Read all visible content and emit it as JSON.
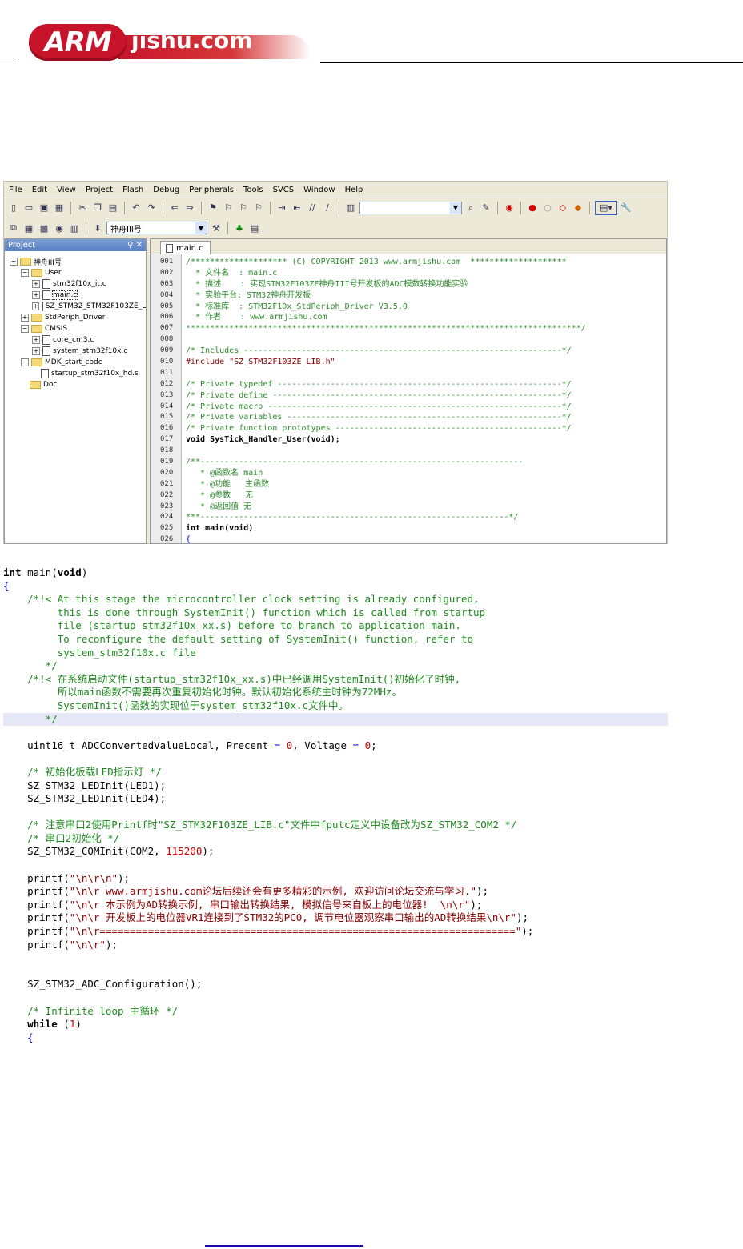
{
  "header": {
    "logo_arm": "ARM",
    "logo_site": "jishu.com"
  },
  "ide": {
    "menu": [
      "File",
      "Edit",
      "View",
      "Project",
      "Flash",
      "Debug",
      "Peripherals",
      "Tools",
      "SVCS",
      "Window",
      "Help"
    ],
    "target_combo": "神舟III号",
    "project_panel_title": "Project",
    "tree": [
      {
        "label": "神舟III号",
        "indent": 0,
        "kind": "folder",
        "pm": "−"
      },
      {
        "label": "User",
        "indent": 1,
        "kind": "folder",
        "pm": "−"
      },
      {
        "label": "stm32f10x_it.c",
        "indent": 2,
        "kind": "file",
        "pm": "+"
      },
      {
        "label": "main.c",
        "indent": 2,
        "kind": "file",
        "pm": "+"
      },
      {
        "label": "SZ_STM32_STM32F103ZE_LIB.c",
        "indent": 2,
        "kind": "file",
        "pm": "+"
      },
      {
        "label": "StdPeriph_Driver",
        "indent": 1,
        "kind": "folder",
        "pm": "+"
      },
      {
        "label": "CMSIS",
        "indent": 1,
        "kind": "folder",
        "pm": "−"
      },
      {
        "label": "core_cm3.c",
        "indent": 2,
        "kind": "file",
        "pm": "+"
      },
      {
        "label": "system_stm32f10x.c",
        "indent": 2,
        "kind": "file",
        "pm": "+"
      },
      {
        "label": "MDK_start_code",
        "indent": 1,
        "kind": "folder",
        "pm": "−"
      },
      {
        "label": "startup_stm32f10x_hd.s",
        "indent": 2,
        "kind": "file",
        "pm": ""
      },
      {
        "label": "Doc",
        "indent": 1,
        "kind": "folder",
        "pm": ""
      }
    ],
    "tab": "main.c",
    "lines": [
      [
        "001",
        "/******************** (C) COPYRIGHT 2013 www.armjishu.com  ********************",
        "g"
      ],
      [
        "002",
        "  * 文件名  : main.c",
        "g"
      ],
      [
        "003",
        "  * 描述    : 实现STM32F103ZE神舟III号开发板的ADC模数转换功能实验",
        "g"
      ],
      [
        "004",
        "  * 实验平台: STM32神舟开发板",
        "g"
      ],
      [
        "005",
        "  * 标准库  : STM32F10x_StdPeriph_Driver V3.5.0",
        "g"
      ],
      [
        "006",
        "  * 作者    : www.armjishu.com",
        "g"
      ],
      [
        "007",
        "**********************************************************************************/",
        "g"
      ],
      [
        "008",
        "",
        ""
      ],
      [
        "009",
        "/* Includes ------------------------------------------------------------------*/",
        "g"
      ],
      [
        "010",
        "#include \"SZ_STM32F103ZE_LIB.h\"",
        "s"
      ],
      [
        "011",
        "",
        ""
      ],
      [
        "012",
        "/* Private typedef -----------------------------------------------------------*/",
        "g"
      ],
      [
        "013",
        "/* Private define ------------------------------------------------------------*/",
        "g"
      ],
      [
        "014",
        "/* Private macro -------------------------------------------------------------*/",
        "g"
      ],
      [
        "015",
        "/* Private variables ---------------------------------------------------------*/",
        "g"
      ],
      [
        "016",
        "/* Private function prototypes -----------------------------------------------*/",
        "g"
      ],
      [
        "017",
        "void SysTick_Handler_User(void);",
        "b"
      ],
      [
        "018",
        "",
        ""
      ],
      [
        "019",
        "/**-------------------------------------------------------------------",
        "g"
      ],
      [
        "020",
        "   * @函数名 main",
        "g"
      ],
      [
        "021",
        "   * @功能   主函数",
        "g"
      ],
      [
        "022",
        "   * @参数   无",
        "g"
      ],
      [
        "023",
        "   * @返回值 无",
        "g"
      ],
      [
        "024",
        "***----------------------------------------------------------------*/",
        "g"
      ],
      [
        "025",
        "int main(void)",
        "b"
      ],
      [
        "026",
        "{",
        "bl"
      ]
    ]
  },
  "code2": [
    {
      "t": "int main(void)",
      "c": "kwline"
    },
    {
      "t": "{",
      "c": "bracket"
    },
    {
      "t": "    /*!< At this stage the microcontroller clock setting is already configured,",
      "c": "cm"
    },
    {
      "t": "         this is done through SystemInit() function which is called from startup",
      "c": "cm"
    },
    {
      "t": "         file (startup_stm32f10x_xx.s) before to branch to application main.",
      "c": "cm"
    },
    {
      "t": "         To reconfigure the default setting of SystemInit() function, refer to",
      "c": "cm"
    },
    {
      "t": "         system_stm32f10x.c file",
      "c": "cm"
    },
    {
      "t": "       */",
      "c": "cm"
    },
    {
      "t": "    /*!< 在系统启动文件(startup_stm32f10x_xx.s)中已经调用SystemInit()初始化了时钟,",
      "c": "cm"
    },
    {
      "t": "         所以main函数不需要再次重复初始化时钟。默认初始化系统主时钟为72MHz。",
      "c": "cm"
    },
    {
      "t": "         SystemInit()函数的实现位于system_stm32f10x.c文件中。",
      "c": "cm"
    },
    {
      "t": "       */",
      "c": "cm hl"
    },
    {
      "t": "",
      "c": ""
    },
    {
      "t": "    uint16_t ADCConvertedValueLocal, Precent = 0, Voltage = 0;",
      "c": "decl"
    },
    {
      "t": "",
      "c": ""
    },
    {
      "t": "    /* 初始化板载LED指示灯 */",
      "c": "cm"
    },
    {
      "t": "    SZ_STM32_LEDInit(LED1);",
      "c": "plain"
    },
    {
      "t": "    SZ_STM32_LEDInit(LED4);",
      "c": "plain"
    },
    {
      "t": "",
      "c": ""
    },
    {
      "t": "    /* 注意串口2使用Printf时\"SZ_STM32F103ZE_LIB.c\"文件中fputc定义中设备改为SZ_STM32_COM2 */",
      "c": "cm"
    },
    {
      "t": "    /* 串口2初始化 */",
      "c": "cm"
    },
    {
      "t": "    SZ_STM32_COMInit(COM2, 115200);",
      "c": "comnum"
    },
    {
      "t": "",
      "c": ""
    },
    {
      "t": "    printf(\"\\n\\r\\n\");",
      "c": "pf"
    },
    {
      "t": "    printf(\"\\n\\r www.armjishu.com论坛后续还会有更多精彩的示例, 欢迎访问论坛交流与学习.\");",
      "c": "pf"
    },
    {
      "t": "    printf(\"\\n\\r 本示例为AD转换示例, 串口输出转换结果, 模拟信号来自板上的电位器!  \\n\\r\");",
      "c": "pf"
    },
    {
      "t": "    printf(\"\\n\\r 开发板上的电位器VR1连接到了STM32的PC0, 调节电位器观察串口输出的AD转换结果\\n\\r\");",
      "c": "pf"
    },
    {
      "t": "    printf(\"\\n\\r=====================================================================\");",
      "c": "pf"
    },
    {
      "t": "    printf(\"\\n\\r\");",
      "c": "pf"
    },
    {
      "t": "",
      "c": ""
    },
    {
      "t": "",
      "c": ""
    },
    {
      "t": "    SZ_STM32_ADC_Configuration();",
      "c": "plain"
    },
    {
      "t": "",
      "c": ""
    },
    {
      "t": "    /* Infinite loop 主循环 */",
      "c": "cm"
    },
    {
      "t": "    while (1)",
      "c": "while"
    },
    {
      "t": "    {",
      "c": "bracket"
    }
  ]
}
